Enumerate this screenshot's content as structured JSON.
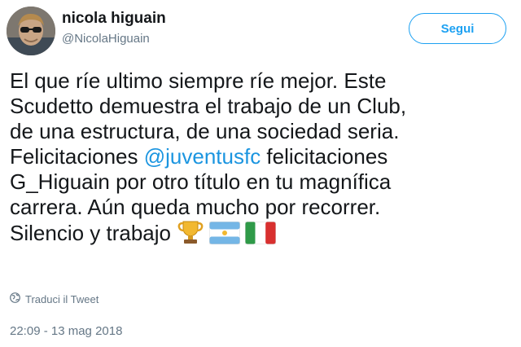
{
  "user": {
    "display_name": "nicola higuain",
    "handle": "@NicolaHiguain",
    "avatar_icon": "profile-photo"
  },
  "actions": {
    "follow_label": "Segui"
  },
  "tweet": {
    "line_1": "El que ríe ultimo siempre ríe mejor. Este",
    "line_2": "Scudetto demuestra el trabajo de un Club,",
    "line_3": "de una estructura, de una sociedad seria.",
    "line_4_prefix": "Felicitaciones ",
    "mention": "@juventusfc",
    "line_4_suffix": " felicitaciones",
    "line_5": "G_Higuain por otro título en tu magnífica",
    "line_6": "carrera. Aún queda mucho por recorrer.",
    "line_7": "Silencio y trabajo",
    "emojis": [
      "trophy-icon",
      "argentina-flag-icon",
      "italy-flag-icon"
    ]
  },
  "translate_label": "Traduci il Tweet",
  "timestamp": "22:09 - 13 mag 2018",
  "colors": {
    "accent": "#1da1f2",
    "link": "#1b95e0",
    "secondary_text": "#657786",
    "primary_text": "#14171a"
  }
}
